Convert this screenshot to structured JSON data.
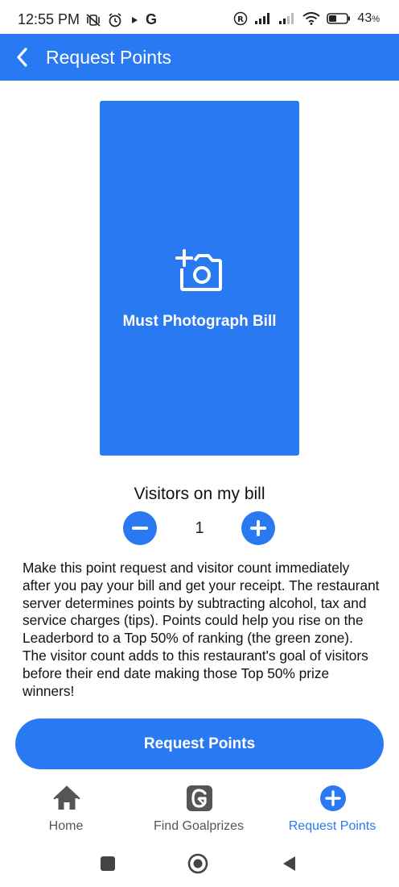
{
  "status_bar": {
    "time": "12:55 PM",
    "carrier_letter": "G",
    "battery_percent": "43",
    "battery_unit": "%",
    "battery_level": 0.43
  },
  "app_bar": {
    "title": "Request Points",
    "icon": "back-arrow-icon",
    "background": "#2979f2"
  },
  "photo_card": {
    "label": "Must Photograph Bill",
    "icon": "add-camera-icon"
  },
  "visitors": {
    "title": "Visitors on my bill",
    "count": "1"
  },
  "description": "Make this point request and visitor count immediately after you pay your bill and get your receipt. The restaurant server determines points by subtracting alcohol, tax and service charges (tips). Points could help you rise on the Leaderbord to a Top 50% of ranking (the green zone). The visitor count adds to this restaurant's goal of visitors before their end date making those Top 50% prize winners!",
  "request_button": {
    "label": "Request Points"
  },
  "bottom_nav": {
    "items": [
      {
        "label": "Home",
        "icon": "home-icon",
        "active": false
      },
      {
        "label": "Find Goalprizes",
        "icon": "goalprizes-logo-icon",
        "active": false
      },
      {
        "label": "Request Points",
        "icon": "add-circle-icon",
        "active": true
      }
    ]
  },
  "colors": {
    "accent": "#2979f2",
    "inactive_nav": "#555555",
    "text": "#111111"
  }
}
